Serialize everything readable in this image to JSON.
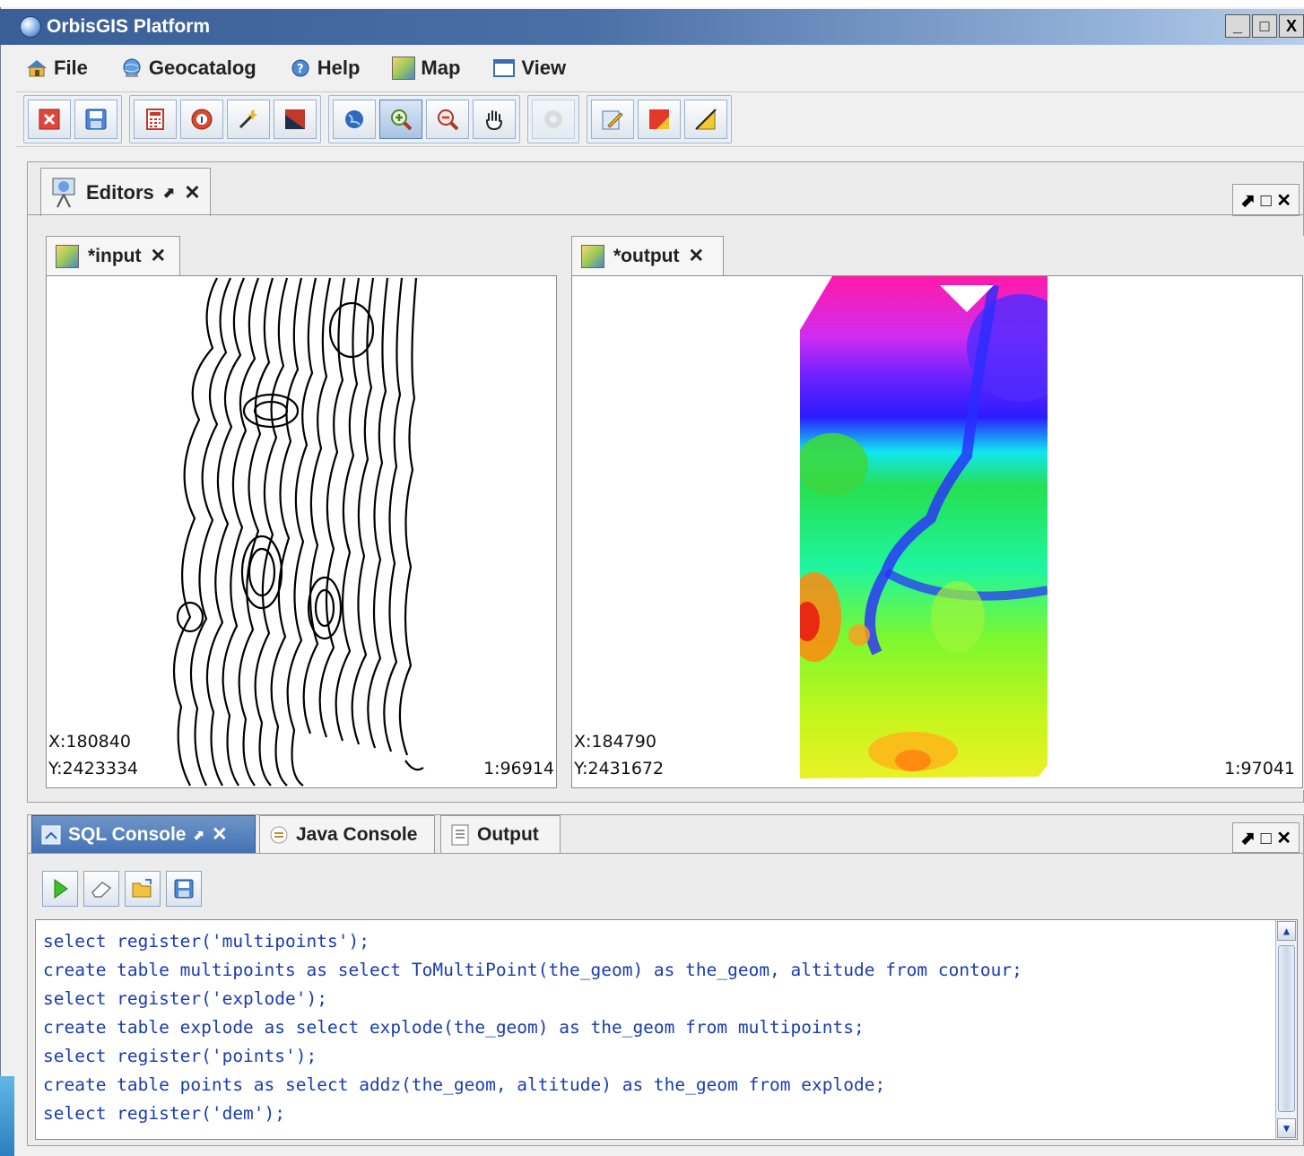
{
  "window": {
    "title": "OrbisGIS Platform",
    "controls": [
      "_",
      "□",
      "X"
    ]
  },
  "menubar": {
    "items": [
      {
        "label": "File",
        "icon": "home-icon"
      },
      {
        "label": "Geocatalog",
        "icon": "globe-catalog-icon"
      },
      {
        "label": "Help",
        "icon": "help-icon"
      },
      {
        "label": "Map",
        "icon": "map-icon"
      },
      {
        "label": "View",
        "icon": "window-icon"
      }
    ]
  },
  "toolbar": {
    "groups": [
      [
        "close-icon",
        "save-icon"
      ],
      [
        "calculator-icon",
        "info-icon",
        "wand-icon",
        "extent-icon"
      ],
      [
        "globe-icon",
        "zoom-in-icon",
        "zoom-out-icon",
        "pan-hand-icon"
      ],
      [
        "disabled-circle-icon"
      ],
      [
        "edit-pencil-icon",
        "select-red-icon",
        "measure-icon"
      ]
    ]
  },
  "editors": {
    "tab_label": "Editors",
    "controls": "⬈ □ ✕",
    "maps": [
      {
        "tab": "*input",
        "x": "X:180840",
        "y": "Y:2423334",
        "scale": "1:96914"
      },
      {
        "tab": "*output",
        "x": "X:184790",
        "y": "Y:2431672",
        "scale": "1:97041"
      }
    ]
  },
  "console": {
    "tabs": [
      {
        "label": "SQL Console",
        "active": true
      },
      {
        "label": "Java Console",
        "active": false
      },
      {
        "label": "Output",
        "active": false
      }
    ],
    "controls": "⬈ □ ✕",
    "tools": [
      "run-icon",
      "clear-icon",
      "open-folder-icon",
      "save-icon"
    ],
    "lines": [
      "select register('multipoints');",
      "create table multipoints as select ToMultiPoint(the_geom) as the_geom, altitude from contour;",
      "select register('explode');",
      "create table explode as select explode(the_geom) as the_geom from multipoints;",
      "select register('points');",
      "create table points as select addz(the_geom, altitude) as the_geom from explode;",
      "select register('dem');"
    ]
  }
}
